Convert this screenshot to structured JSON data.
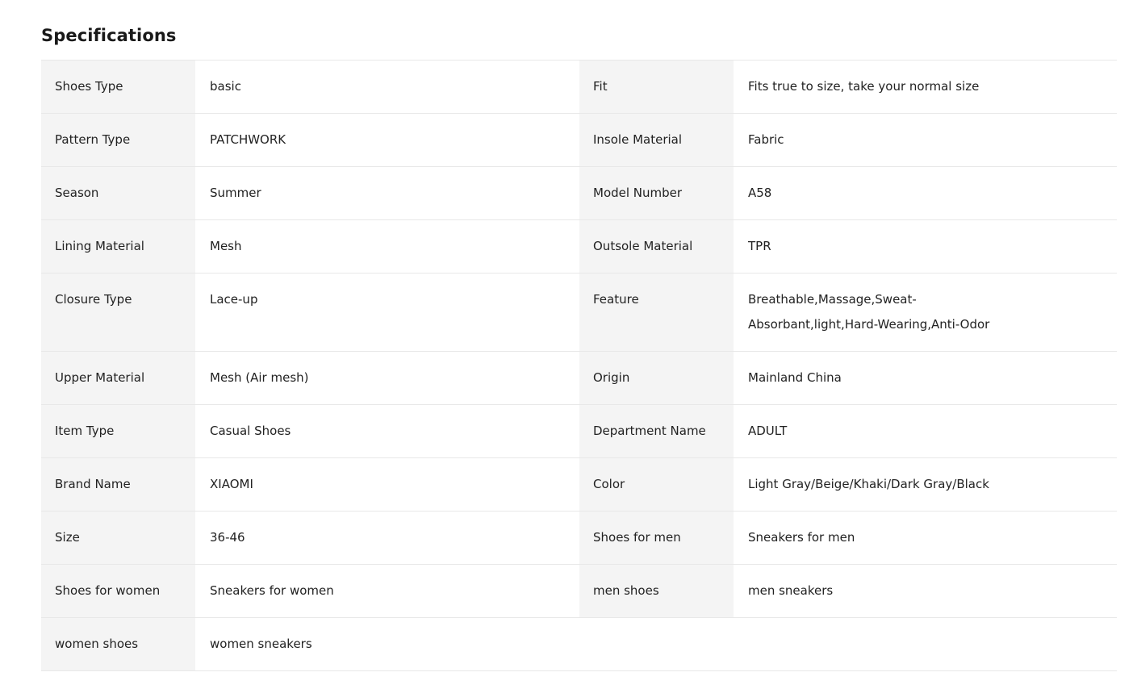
{
  "section": {
    "title": "Specifications"
  },
  "specs": [
    {
      "name": "Shoes Type",
      "value": "basic"
    },
    {
      "name": "Fit",
      "value": "Fits true to size, take your normal size"
    },
    {
      "name": "Pattern Type",
      "value": "PATCHWORK"
    },
    {
      "name": "Insole Material",
      "value": "Fabric"
    },
    {
      "name": "Season",
      "value": "Summer"
    },
    {
      "name": "Model Number",
      "value": "A58"
    },
    {
      "name": "Lining Material",
      "value": "Mesh"
    },
    {
      "name": "Outsole Material",
      "value": "TPR"
    },
    {
      "name": "Closure Type",
      "value": "Lace-up"
    },
    {
      "name": "Feature",
      "value": "Breathable,Massage,Sweat-Absorbant,light,Hard-Wearing,Anti-Odor"
    },
    {
      "name": "Upper Material",
      "value": "Mesh (Air mesh)"
    },
    {
      "name": "Origin",
      "value": "Mainland China"
    },
    {
      "name": "Item Type",
      "value": "Casual Shoes"
    },
    {
      "name": "Department Name",
      "value": "ADULT"
    },
    {
      "name": "Brand Name",
      "value": "XIAOMI"
    },
    {
      "name": "Color",
      "value": "Light Gray/Beige/Khaki/Dark Gray/Black"
    },
    {
      "name": "Size",
      "value": "36-46"
    },
    {
      "name": "Shoes for men",
      "value": "Sneakers for men"
    },
    {
      "name": "Shoes for women",
      "value": "Sneakers for women"
    },
    {
      "name": "men shoes",
      "value": "men sneakers"
    },
    {
      "name": "women shoes",
      "value": "women sneakers"
    }
  ]
}
